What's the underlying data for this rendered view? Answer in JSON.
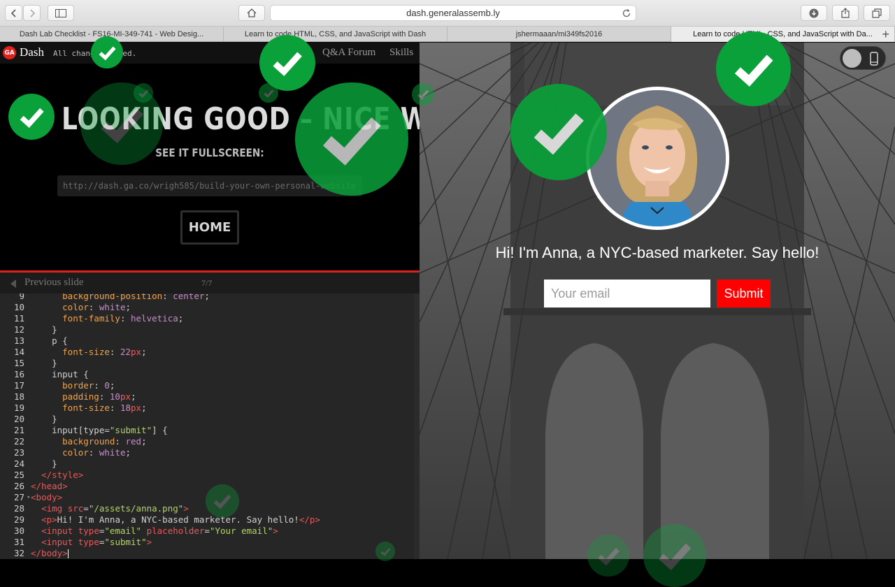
{
  "browser": {
    "url": "dash.generalassemb.ly",
    "tabs": [
      {
        "label": "Dash Lab Checklist - FS16-MI-349-741 - Web Desig..."
      },
      {
        "label": "Learn to code HTML, CSS, and JavaScript with Dash"
      },
      {
        "label": "jshermaaan/mi349fs2016"
      },
      {
        "label": "Learn to code HTML, CSS, and JavaScript with Da..."
      }
    ],
    "new_tab": "+"
  },
  "dash": {
    "logo": "GA",
    "name": "Dash",
    "save_status": "All changes saved.",
    "nav_forum": "Q&A Forum",
    "nav_skills": "Skills"
  },
  "completion": {
    "headline": "LOOKING GOOD – NICE WORK!",
    "see_fullscreen": "SEE IT FULLSCREEN:",
    "fullscreen_url": "http://dash.ga.co/wrigh585/build-your-own-personal-website",
    "home_label": "HOME"
  },
  "slide_nav": {
    "previous": "Previous slide",
    "count": "7/7"
  },
  "code": {
    "lines": [
      {
        "n": "10",
        "t": "      color: white;"
      },
      {
        "n": "11",
        "t": "      font-family: helvetica;"
      },
      {
        "n": "12",
        "t": "    }"
      },
      {
        "n": "13",
        "t": "    p {"
      },
      {
        "n": "14",
        "t": "      font-size: 22px;"
      },
      {
        "n": "15",
        "t": "    }"
      },
      {
        "n": "16",
        "t": "    input {"
      },
      {
        "n": "17",
        "t": "      border: 0;"
      },
      {
        "n": "18",
        "t": "      padding: 10px;"
      },
      {
        "n": "19",
        "t": "      font-size: 18px;"
      },
      {
        "n": "20",
        "t": "    }"
      },
      {
        "n": "21",
        "t": "    input[type=\"submit\"] {"
      },
      {
        "n": "22",
        "t": "      background: red;"
      },
      {
        "n": "23",
        "t": "      color: white;"
      },
      {
        "n": "24",
        "t": "    }"
      },
      {
        "n": "25",
        "t": "  </style>"
      },
      {
        "n": "26",
        "t": "</head>"
      },
      {
        "n": "27",
        "t": "<body>"
      },
      {
        "n": "28",
        "t": "  <img src=\"/assets/anna.png\">"
      },
      {
        "n": "29",
        "t": "  <p>Hi! I'm Anna, a NYC-based marketer. Say hello!</p>"
      },
      {
        "n": "30",
        "t": "  <input type=\"email\" placeholder=\"Your email\">"
      },
      {
        "n": "31",
        "t": "  <input type=\"submit\">"
      },
      {
        "n": "32",
        "t": "</body>"
      }
    ]
  },
  "preview": {
    "tagline": "Hi! I'm Anna, a NYC-based marketer. Say hello!",
    "email_placeholder": "Your email",
    "submit_label": "Submit"
  },
  "colors": {
    "badge_green": "#0aa03a",
    "ga_red": "#e0221f",
    "submit_red": "#ff0000"
  }
}
